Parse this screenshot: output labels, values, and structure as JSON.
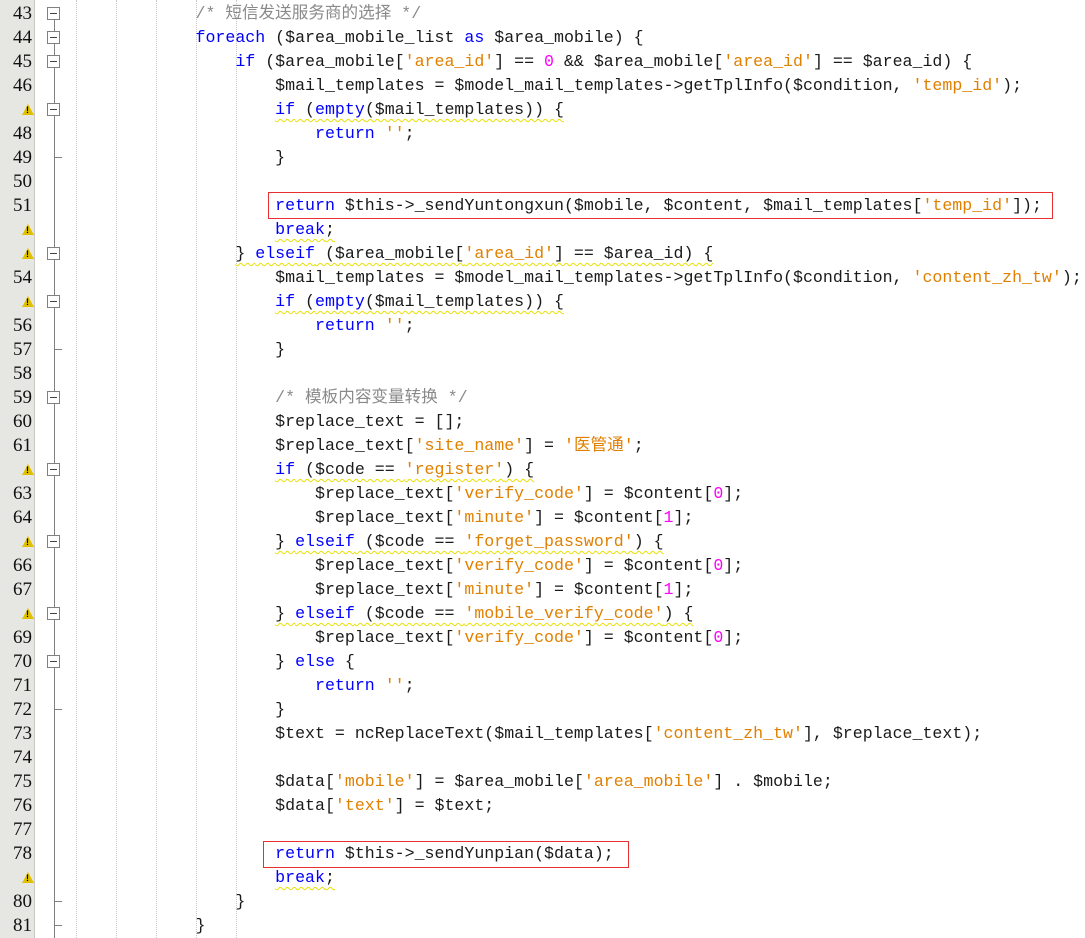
{
  "colors": {
    "keyword": "#0000ff",
    "string": "#e08000",
    "number": "#ff00ff",
    "comment": "#8a8a8a",
    "text": "#1a1a1a",
    "highlight": "#e83030",
    "warning": "#e0c000"
  },
  "lines": [
    {
      "n": "43",
      "indent": 12,
      "fold": "box",
      "t": [
        [
          "c",
          "/* 短信发送服务商的选择 */"
        ]
      ]
    },
    {
      "n": "44",
      "indent": 12,
      "fold": "box",
      "t": [
        [
          "k",
          "foreach"
        ],
        [
          "v",
          " ($area_mobile_list "
        ],
        [
          "k",
          "as"
        ],
        [
          "v",
          " $area_mobile) {"
        ]
      ]
    },
    {
      "n": "45",
      "indent": 16,
      "fold": "box",
      "t": [
        [
          "k",
          "if"
        ],
        [
          "v",
          " ($area_mobile["
        ],
        [
          "s",
          "'area_id'"
        ],
        [
          "v",
          "] == "
        ],
        [
          "n",
          "0"
        ],
        [
          "v",
          " && $area_mobile["
        ],
        [
          "s",
          "'area_id'"
        ],
        [
          "v",
          "] == $area_id) {"
        ]
      ]
    },
    {
      "n": "46",
      "indent": 20,
      "t": [
        [
          "v",
          "$mail_templates = $model_mail_templates->getTplInfo($condition, "
        ],
        [
          "s",
          "'temp_id'"
        ],
        [
          "v",
          ");"
        ]
      ]
    },
    {
      "n": "",
      "warn": true,
      "indent": 20,
      "fold": "box",
      "t": [
        [
          "k",
          "if"
        ],
        [
          "v",
          " ("
        ],
        [
          "k",
          "empty"
        ],
        [
          "v",
          "($mail_templates)) {"
        ]
      ]
    },
    {
      "n": "48",
      "indent": 24,
      "t": [
        [
          "k",
          "return"
        ],
        [
          "v",
          " "
        ],
        [
          "s",
          "''"
        ],
        [
          "v",
          ";"
        ]
      ]
    },
    {
      "n": "49",
      "indent": 20,
      "fold": "end",
      "t": [
        [
          "v",
          "}"
        ]
      ]
    },
    {
      "n": "50",
      "indent": 0,
      "t": []
    },
    {
      "n": "51",
      "indent": 20,
      "t": [
        [
          "k",
          "return"
        ],
        [
          "v",
          " $this->_sendYuntongxun($mobile, $content, $mail_templates["
        ],
        [
          "s",
          "'temp_id'"
        ],
        [
          "v",
          "]);"
        ]
      ]
    },
    {
      "n": "",
      "warn": true,
      "indent": 20,
      "t": [
        [
          "k",
          "break"
        ],
        [
          "v",
          ";"
        ]
      ]
    },
    {
      "n": "",
      "warn": true,
      "indent": 16,
      "fold": "box",
      "t": [
        [
          "v",
          "} "
        ],
        [
          "k",
          "elseif"
        ],
        [
          "v",
          " ($area_mobile["
        ],
        [
          "s",
          "'area_id'"
        ],
        [
          "v",
          "] == $area_id) {"
        ]
      ]
    },
    {
      "n": "54",
      "indent": 20,
      "t": [
        [
          "v",
          "$mail_templates = $model_mail_templates->getTplInfo($condition, "
        ],
        [
          "s",
          "'content_zh_tw'"
        ],
        [
          "v",
          ");"
        ]
      ]
    },
    {
      "n": "",
      "warn": true,
      "indent": 20,
      "fold": "box",
      "t": [
        [
          "k",
          "if"
        ],
        [
          "v",
          " ("
        ],
        [
          "k",
          "empty"
        ],
        [
          "v",
          "($mail_templates)) {"
        ]
      ]
    },
    {
      "n": "56",
      "indent": 24,
      "t": [
        [
          "k",
          "return"
        ],
        [
          "v",
          " "
        ],
        [
          "s",
          "''"
        ],
        [
          "v",
          ";"
        ]
      ]
    },
    {
      "n": "57",
      "indent": 20,
      "fold": "end",
      "t": [
        [
          "v",
          "}"
        ]
      ]
    },
    {
      "n": "58",
      "indent": 0,
      "t": []
    },
    {
      "n": "59",
      "indent": 20,
      "fold": "box",
      "t": [
        [
          "c",
          "/* 模板内容变量转换 */"
        ]
      ]
    },
    {
      "n": "60",
      "indent": 20,
      "t": [
        [
          "v",
          "$replace_text = [];"
        ]
      ]
    },
    {
      "n": "61",
      "indent": 20,
      "t": [
        [
          "v",
          "$replace_text["
        ],
        [
          "s",
          "'site_name'"
        ],
        [
          "v",
          "] = "
        ],
        [
          "s",
          "'医管通'"
        ],
        [
          "v",
          ";"
        ]
      ]
    },
    {
      "n": "",
      "warn": true,
      "indent": 20,
      "fold": "box",
      "t": [
        [
          "k",
          "if"
        ],
        [
          "v",
          " ($code == "
        ],
        [
          "s",
          "'register'"
        ],
        [
          "v",
          ") {"
        ]
      ]
    },
    {
      "n": "63",
      "indent": 24,
      "t": [
        [
          "v",
          "$replace_text["
        ],
        [
          "s",
          "'verify_code'"
        ],
        [
          "v",
          "] = $content["
        ],
        [
          "n",
          "0"
        ],
        [
          "v",
          "];"
        ]
      ]
    },
    {
      "n": "64",
      "indent": 24,
      "t": [
        [
          "v",
          "$replace_text["
        ],
        [
          "s",
          "'minute'"
        ],
        [
          "v",
          "] = $content["
        ],
        [
          "n",
          "1"
        ],
        [
          "v",
          "];"
        ]
      ]
    },
    {
      "n": "",
      "warn": true,
      "indent": 20,
      "fold": "box",
      "t": [
        [
          "v",
          "} "
        ],
        [
          "k",
          "elseif"
        ],
        [
          "v",
          " ($code == "
        ],
        [
          "s",
          "'forget_password'"
        ],
        [
          "v",
          ") {"
        ]
      ]
    },
    {
      "n": "66",
      "indent": 24,
      "t": [
        [
          "v",
          "$replace_text["
        ],
        [
          "s",
          "'verify_code'"
        ],
        [
          "v",
          "] = $content["
        ],
        [
          "n",
          "0"
        ],
        [
          "v",
          "];"
        ]
      ]
    },
    {
      "n": "67",
      "indent": 24,
      "t": [
        [
          "v",
          "$replace_text["
        ],
        [
          "s",
          "'minute'"
        ],
        [
          "v",
          "] = $content["
        ],
        [
          "n",
          "1"
        ],
        [
          "v",
          "];"
        ]
      ]
    },
    {
      "n": "",
      "warn": true,
      "indent": 20,
      "fold": "box",
      "t": [
        [
          "v",
          "} "
        ],
        [
          "k",
          "elseif"
        ],
        [
          "v",
          " ($code == "
        ],
        [
          "s",
          "'mobile_verify_code'"
        ],
        [
          "v",
          ") {"
        ]
      ]
    },
    {
      "n": "69",
      "indent": 24,
      "t": [
        [
          "v",
          "$replace_text["
        ],
        [
          "s",
          "'verify_code'"
        ],
        [
          "v",
          "] = $content["
        ],
        [
          "n",
          "0"
        ],
        [
          "v",
          "];"
        ]
      ]
    },
    {
      "n": "70",
      "indent": 20,
      "fold": "box",
      "t": [
        [
          "v",
          "} "
        ],
        [
          "k",
          "else"
        ],
        [
          "v",
          " {"
        ]
      ]
    },
    {
      "n": "71",
      "indent": 24,
      "t": [
        [
          "k",
          "return"
        ],
        [
          "v",
          " "
        ],
        [
          "s",
          "''"
        ],
        [
          "v",
          ";"
        ]
      ]
    },
    {
      "n": "72",
      "indent": 20,
      "fold": "end",
      "t": [
        [
          "v",
          "}"
        ]
      ]
    },
    {
      "n": "73",
      "indent": 20,
      "t": [
        [
          "v",
          "$text = ncReplaceText($mail_templates["
        ],
        [
          "s",
          "'content_zh_tw'"
        ],
        [
          "v",
          "], $replace_text);"
        ]
      ]
    },
    {
      "n": "74",
      "indent": 0,
      "t": []
    },
    {
      "n": "75",
      "indent": 20,
      "t": [
        [
          "v",
          "$data["
        ],
        [
          "s",
          "'mobile'"
        ],
        [
          "v",
          "] = $area_mobile["
        ],
        [
          "s",
          "'area_mobile'"
        ],
        [
          "v",
          "] . $mobile;"
        ]
      ]
    },
    {
      "n": "76",
      "indent": 20,
      "t": [
        [
          "v",
          "$data["
        ],
        [
          "s",
          "'text'"
        ],
        [
          "v",
          "] = $text;"
        ]
      ]
    },
    {
      "n": "77",
      "indent": 0,
      "t": []
    },
    {
      "n": "78",
      "indent": 20,
      "t": [
        [
          "k",
          "return"
        ],
        [
          "v",
          " $this->_sendYunpian($data);"
        ]
      ]
    },
    {
      "n": "",
      "warn": true,
      "indent": 20,
      "t": [
        [
          "k",
          "break"
        ],
        [
          "v",
          ";"
        ]
      ]
    },
    {
      "n": "80",
      "indent": 16,
      "fold": "end",
      "t": [
        [
          "v",
          "}"
        ]
      ]
    },
    {
      "n": "81",
      "indent": 12,
      "fold": "end",
      "t": [
        [
          "v",
          "}"
        ]
      ]
    }
  ]
}
